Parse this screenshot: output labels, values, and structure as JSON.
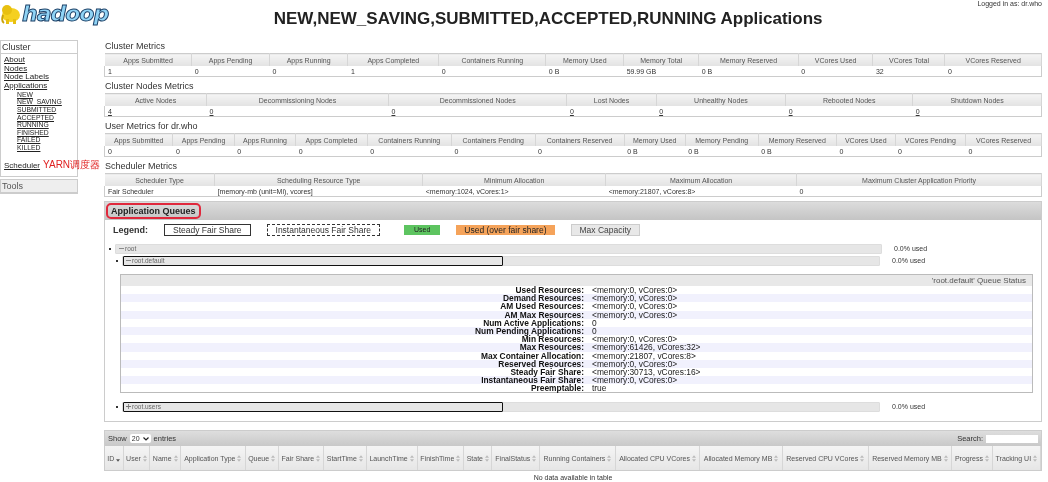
{
  "header": {
    "logo": "hadoop",
    "title": "NEW,NEW_SAVING,SUBMITTED,ACCEPTED,RUNNING Applications",
    "logged_in": "Logged in as: dr.who"
  },
  "sidebar": {
    "sections": [
      {
        "title": "Cluster",
        "items": [
          {
            "label": "About"
          },
          {
            "label": "Nodes"
          },
          {
            "label": "Node Labels"
          },
          {
            "label": "Applications",
            "children": [
              {
                "label": "NEW"
              },
              {
                "label": "NEW_SAVING"
              },
              {
                "label": "SUBMITTED"
              },
              {
                "label": "ACCEPTED"
              },
              {
                "label": "RUNNING"
              },
              {
                "label": "FINISHED"
              },
              {
                "label": "FAILED"
              },
              {
                "label": "KILLED"
              }
            ]
          },
          {
            "label": "Scheduler",
            "annotation": "YARN调度器"
          }
        ]
      },
      {
        "title": "Tools"
      }
    ]
  },
  "metrics": [
    {
      "title": "Cluster Metrics",
      "columns": [
        "Apps Submitted",
        "Apps Pending",
        "Apps Running",
        "Apps Completed",
        "Containers Running",
        "Memory Used",
        "Memory Total",
        "Memory Reserved",
        "VCores Used",
        "VCores Total",
        "VCores Reserved"
      ],
      "rows": [
        [
          "1",
          "0",
          "0",
          "1",
          "0",
          "0 B",
          "59.99 GB",
          "0 B",
          "0",
          "32",
          "0"
        ]
      ]
    },
    {
      "title": "Cluster Nodes Metrics",
      "links": true,
      "columns": [
        "Active Nodes",
        "Decommissioning Nodes",
        "Decommissioned Nodes",
        "Lost Nodes",
        "Unhealthy Nodes",
        "Rebooted Nodes",
        "Shutdown Nodes"
      ],
      "rows": [
        [
          "4",
          "0",
          "0",
          "0",
          "0",
          "0",
          "0"
        ]
      ]
    },
    {
      "title": "User Metrics for dr.who",
      "columns": [
        "Apps Submitted",
        "Apps Pending",
        "Apps Running",
        "Apps Completed",
        "Containers Running",
        "Containers Pending",
        "Containers Reserved",
        "Memory Used",
        "Memory Pending",
        "Memory Reserved",
        "VCores Used",
        "VCores Pending",
        "VCores Reserved"
      ],
      "rows": [
        [
          "0",
          "0",
          "0",
          "0",
          "0",
          "0",
          "0",
          "0 B",
          "0 B",
          "0 B",
          "0",
          "0",
          "0"
        ]
      ]
    },
    {
      "title": "Scheduler Metrics",
      "columns": [
        "Scheduler Type",
        "Scheduling Resource Type",
        "Minimum Allocation",
        "Maximum Allocation",
        "Maximum Cluster Application Priority"
      ],
      "rows": [
        [
          "Fair Scheduler",
          "[memory-mb (unit=Mi), vcores]",
          "<memory:1024, vCores:1>",
          "<memory:21807, vCores:8>",
          "0"
        ]
      ]
    }
  ],
  "queues": {
    "title": "Application Queues",
    "highlighted": true,
    "legend_label": "Legend:",
    "legend": [
      {
        "kind": "steady",
        "label": "Steady Fair Share"
      },
      {
        "kind": "instantaneous",
        "label": "Instantaneous Fair Share"
      },
      {
        "kind": "used",
        "label": "Used"
      },
      {
        "kind": "over",
        "label": "Used (over fair share)"
      },
      {
        "kind": "max",
        "label": "Max Capacity"
      }
    ],
    "tree": [
      {
        "name": "root",
        "expanded": true,
        "outlined": false,
        "level": 0,
        "used": "0.0% used",
        "children": [
          {
            "name": "root.default",
            "expanded": true,
            "outlined": true,
            "level": 0,
            "used": "0.0% used",
            "status": {
              "title": "'root.default' Queue Status",
              "rows": [
                {
                  "label": "Used Resources:",
                  "value": "<memory:0, vCores:0>"
                },
                {
                  "label": "Demand Resources:",
                  "value": "<memory:0, vCores:0>"
                },
                {
                  "label": "AM Used Resources:",
                  "value": "<memory:0, vCores:0>"
                },
                {
                  "label": "AM Max Resources:",
                  "value": "<memory:0, vCores:0>"
                },
                {
                  "label": "Num Active Applications:",
                  "value": "0"
                },
                {
                  "label": "Num Pending Applications:",
                  "value": "0"
                },
                {
                  "label": "Min Resources:",
                  "value": "<memory:0, vCores:0>"
                },
                {
                  "label": "Max Resources:",
                  "value": "<memory:61426, vCores:32>"
                },
                {
                  "label": "Max Container Allocation:",
                  "value": "<memory:21807, vCores:8>"
                },
                {
                  "label": "Reserved Resources:",
                  "value": "<memory:0, vCores:0>"
                },
                {
                  "label": "Steady Fair Share:",
                  "value": "<memory:30713, vCores:16>"
                },
                {
                  "label": "Instantaneous Fair Share:",
                  "value": "<memory:0, vCores:0>"
                },
                {
                  "label": "Preemptable:",
                  "value": "true"
                }
              ]
            }
          },
          {
            "name": "root.users",
            "expanded": false,
            "outlined": true,
            "level": 0,
            "used": "0.0% used"
          }
        ]
      }
    ]
  },
  "apps": {
    "show_label": "Show",
    "page_size": "20",
    "entries_label": "entries",
    "search_label": "Search:",
    "columns": [
      {
        "label": "ID",
        "sorted": true
      },
      {
        "label": "User",
        "sorted": false
      },
      {
        "label": "Name",
        "sorted": false
      },
      {
        "label": "Application Type",
        "sorted": false
      },
      {
        "label": "Queue",
        "sorted": false
      },
      {
        "label": "Fair Share",
        "sorted": false
      },
      {
        "label": "StartTime",
        "sorted": false
      },
      {
        "label": "LaunchTime",
        "sorted": false
      },
      {
        "label": "FinishTime",
        "sorted": false
      },
      {
        "label": "State",
        "sorted": false
      },
      {
        "label": "FinalStatus",
        "sorted": false
      },
      {
        "label": "Running Containers",
        "sorted": false
      },
      {
        "label": "Allocated CPU VCores",
        "sorted": false
      },
      {
        "label": "Allocated Memory MB",
        "sorted": false
      },
      {
        "label": "Reserved CPU VCores",
        "sorted": false
      },
      {
        "label": "Reserved Memory MB",
        "sorted": false
      },
      {
        "label": "Progress",
        "sorted": false
      },
      {
        "label": "Tracking UI",
        "sorted": false
      }
    ],
    "empty": "No data available in table"
  }
}
